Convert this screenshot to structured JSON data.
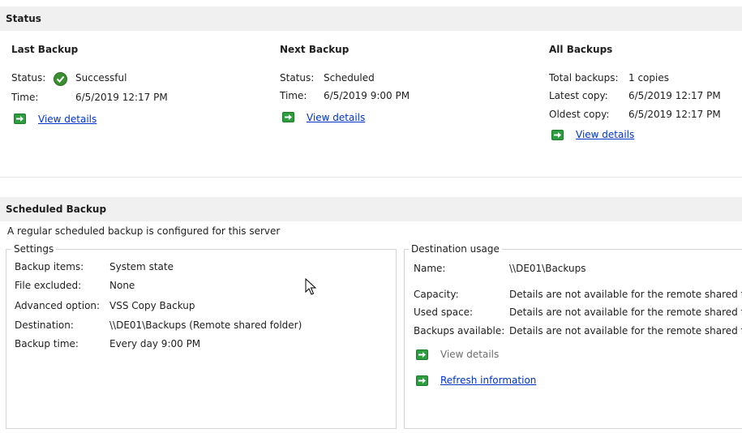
{
  "status": {
    "header": "Status",
    "last_backup": {
      "title": "Last Backup",
      "status_label": "Status:",
      "status_value": "Successful",
      "status_icon": "success-check-icon",
      "time_label": "Time:",
      "time_value": "6/5/2019 12:17 PM",
      "view_details": "View details"
    },
    "next_backup": {
      "title": "Next Backup",
      "status_label": "Status:",
      "status_value": "Scheduled",
      "time_label": "Time:",
      "time_value": "6/5/2019 9:00 PM",
      "view_details": "View details"
    },
    "all_backups": {
      "title": "All Backups",
      "total_label": "Total backups:",
      "total_value": "1 copies",
      "latest_label": "Latest copy:",
      "latest_value": "6/5/2019 12:17 PM",
      "oldest_label": "Oldest copy:",
      "oldest_value": "6/5/2019 12:17 PM",
      "view_details": "View details"
    }
  },
  "scheduled": {
    "header": "Scheduled Backup",
    "description": "A regular scheduled backup is configured for this server",
    "settings": {
      "legend": "Settings",
      "rows": [
        {
          "label": "Backup items:",
          "value": "System state"
        },
        {
          "label": "File excluded:",
          "value": "None"
        },
        {
          "label": "Advanced option:",
          "value": "VSS Copy Backup"
        },
        {
          "label": "Destination:",
          "value": "\\\\DE01\\Backups (Remote shared folder)"
        },
        {
          "label": "Backup time:",
          "value": "Every day 9:00 PM"
        }
      ]
    },
    "destination": {
      "legend": "Destination usage",
      "name_label": "Name:",
      "name_value": "\\\\DE01\\Backups",
      "capacity_label": "Capacity:",
      "capacity_value": "Details are not available for the remote shared fold",
      "used_label": "Used space:",
      "used_value": "Details are not available for the remote shared fold",
      "available_label": "Backups available:",
      "available_value": "Details are not available for the remote shared fold",
      "view_details": "View details",
      "refresh": "Refresh information"
    }
  },
  "colors": {
    "header_bg": "#f0f0f0",
    "link": "#0033cc",
    "icon_green": "#2e9d3f"
  }
}
